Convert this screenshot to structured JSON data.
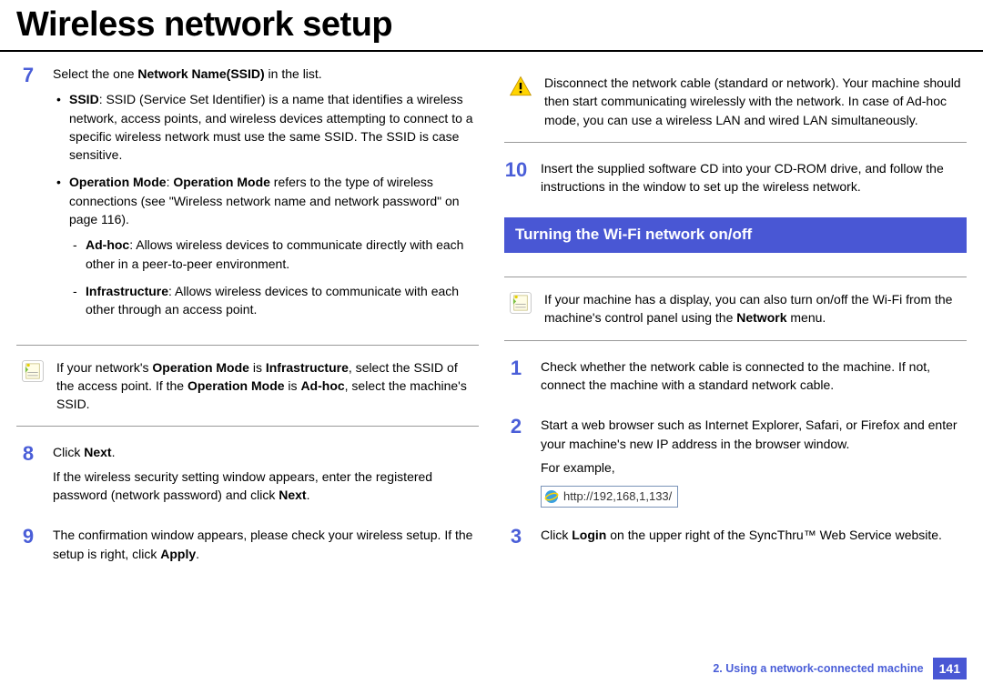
{
  "title": "Wireless network setup",
  "left": {
    "step7": {
      "num": "7",
      "intro_a": "Select the one ",
      "intro_b": "Network Name(SSID)",
      "intro_c": " in the list.",
      "bullet1_b": "SSID",
      "bullet1_rest": ": SSID (Service Set Identifier) is a name that identifies a wireless network, access points, and wireless devices attempting to connect to a specific wireless network must use the same SSID. The SSID is case sensitive.",
      "bullet2_b1": "Operation Mode",
      "bullet2_mid": ": ",
      "bullet2_b2": "Operation Mode",
      "bullet2_rest": " refers to the type of wireless connections (see \"Wireless network name and network password\" on page 116).",
      "sub1_b": "Ad-hoc",
      "sub1_rest": ": Allows wireless devices to communicate directly with each other in a peer-to-peer environment.",
      "sub2_b": "Infrastructure",
      "sub2_rest": ": Allows wireless devices to communicate with each other through an access point."
    },
    "note": {
      "a": "If your network's ",
      "b1": "Operation Mode",
      "c": " is ",
      "b2": "Infrastructure",
      "d": ", select the SSID of the access point. If the ",
      "b3": "Operation Mode",
      "e": " is ",
      "b4": "Ad-hoc",
      "f": ", select the machine's SSID."
    },
    "step8": {
      "num": "8",
      "a": "Click ",
      "b": "Next",
      "c": ".",
      "p2a": "If the wireless security setting window appears, enter the registered password (network password) and click ",
      "p2b": "Next",
      "p2c": "."
    },
    "step9": {
      "num": "9",
      "a": "The confirmation window appears, please check your wireless setup. If the setup is right, click ",
      "b": "Apply",
      "c": "."
    }
  },
  "right": {
    "warn": "Disconnect the network cable (standard or network). Your machine should then start communicating wirelessly with the network. In case of Ad-hoc mode, you can use a wireless LAN and wired LAN simultaneously.",
    "step10": {
      "num": "10",
      "text": "Insert the supplied software CD into your CD-ROM drive, and follow the instructions in the window to set up the wireless network."
    },
    "section": "Turning the Wi-Fi network on/off",
    "note": {
      "a": "If your machine has a display, you can also turn on/off the Wi-Fi from the machine's control panel using the ",
      "b": "Network",
      "c": " menu."
    },
    "step1": {
      "num": "1",
      "text": "Check whether the network cable is connected to the machine. If not, connect the machine with a standard network cable."
    },
    "step2": {
      "num": "2",
      "text": "Start a web browser such as Internet Explorer, Safari, or Firefox and enter your machine's new IP address in the browser window.",
      "eg": "For example,",
      "url": "http://192,168,1,133/"
    },
    "step3": {
      "num": "3",
      "a": "Click ",
      "b": "Login",
      "c": " on the upper right of the SyncThru™ Web Service website."
    }
  },
  "footer": {
    "chapter": "2.  Using a network-connected machine",
    "page": "141"
  }
}
